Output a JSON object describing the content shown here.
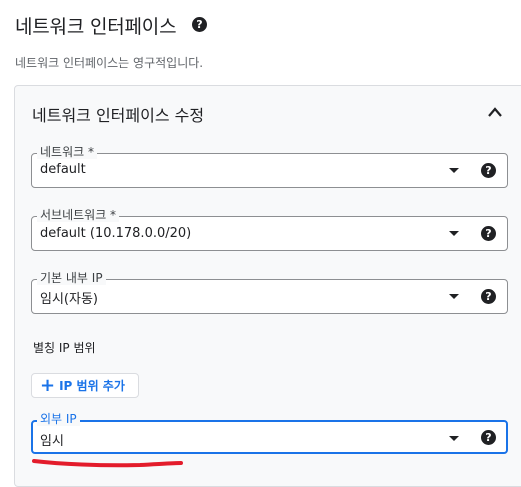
{
  "header": {
    "title": "네트워크 인터페이스",
    "help_icon": "help-circle-icon",
    "subtitle": "네트워크 인터페이스는 영구적입니다."
  },
  "panel": {
    "title": "네트워크 인터페이스 수정",
    "collapse_icon": "chevron-up-icon"
  },
  "fields": {
    "network": {
      "label": "네트워크 *",
      "value": "default"
    },
    "subnetwork": {
      "label": "서브네트워크 *",
      "value": "default (10.178.0.0/20)"
    },
    "internal_ip": {
      "label": "기본 내부 IP",
      "value": "임시(자동)"
    },
    "external_ip": {
      "label": "외부 IP",
      "value": "임시"
    }
  },
  "alias_ip": {
    "label": "별칭 IP 범위",
    "add_button": "IP 범위 추가"
  },
  "colors": {
    "accent": "#1a73e8",
    "annotation": "#e31c2b"
  }
}
